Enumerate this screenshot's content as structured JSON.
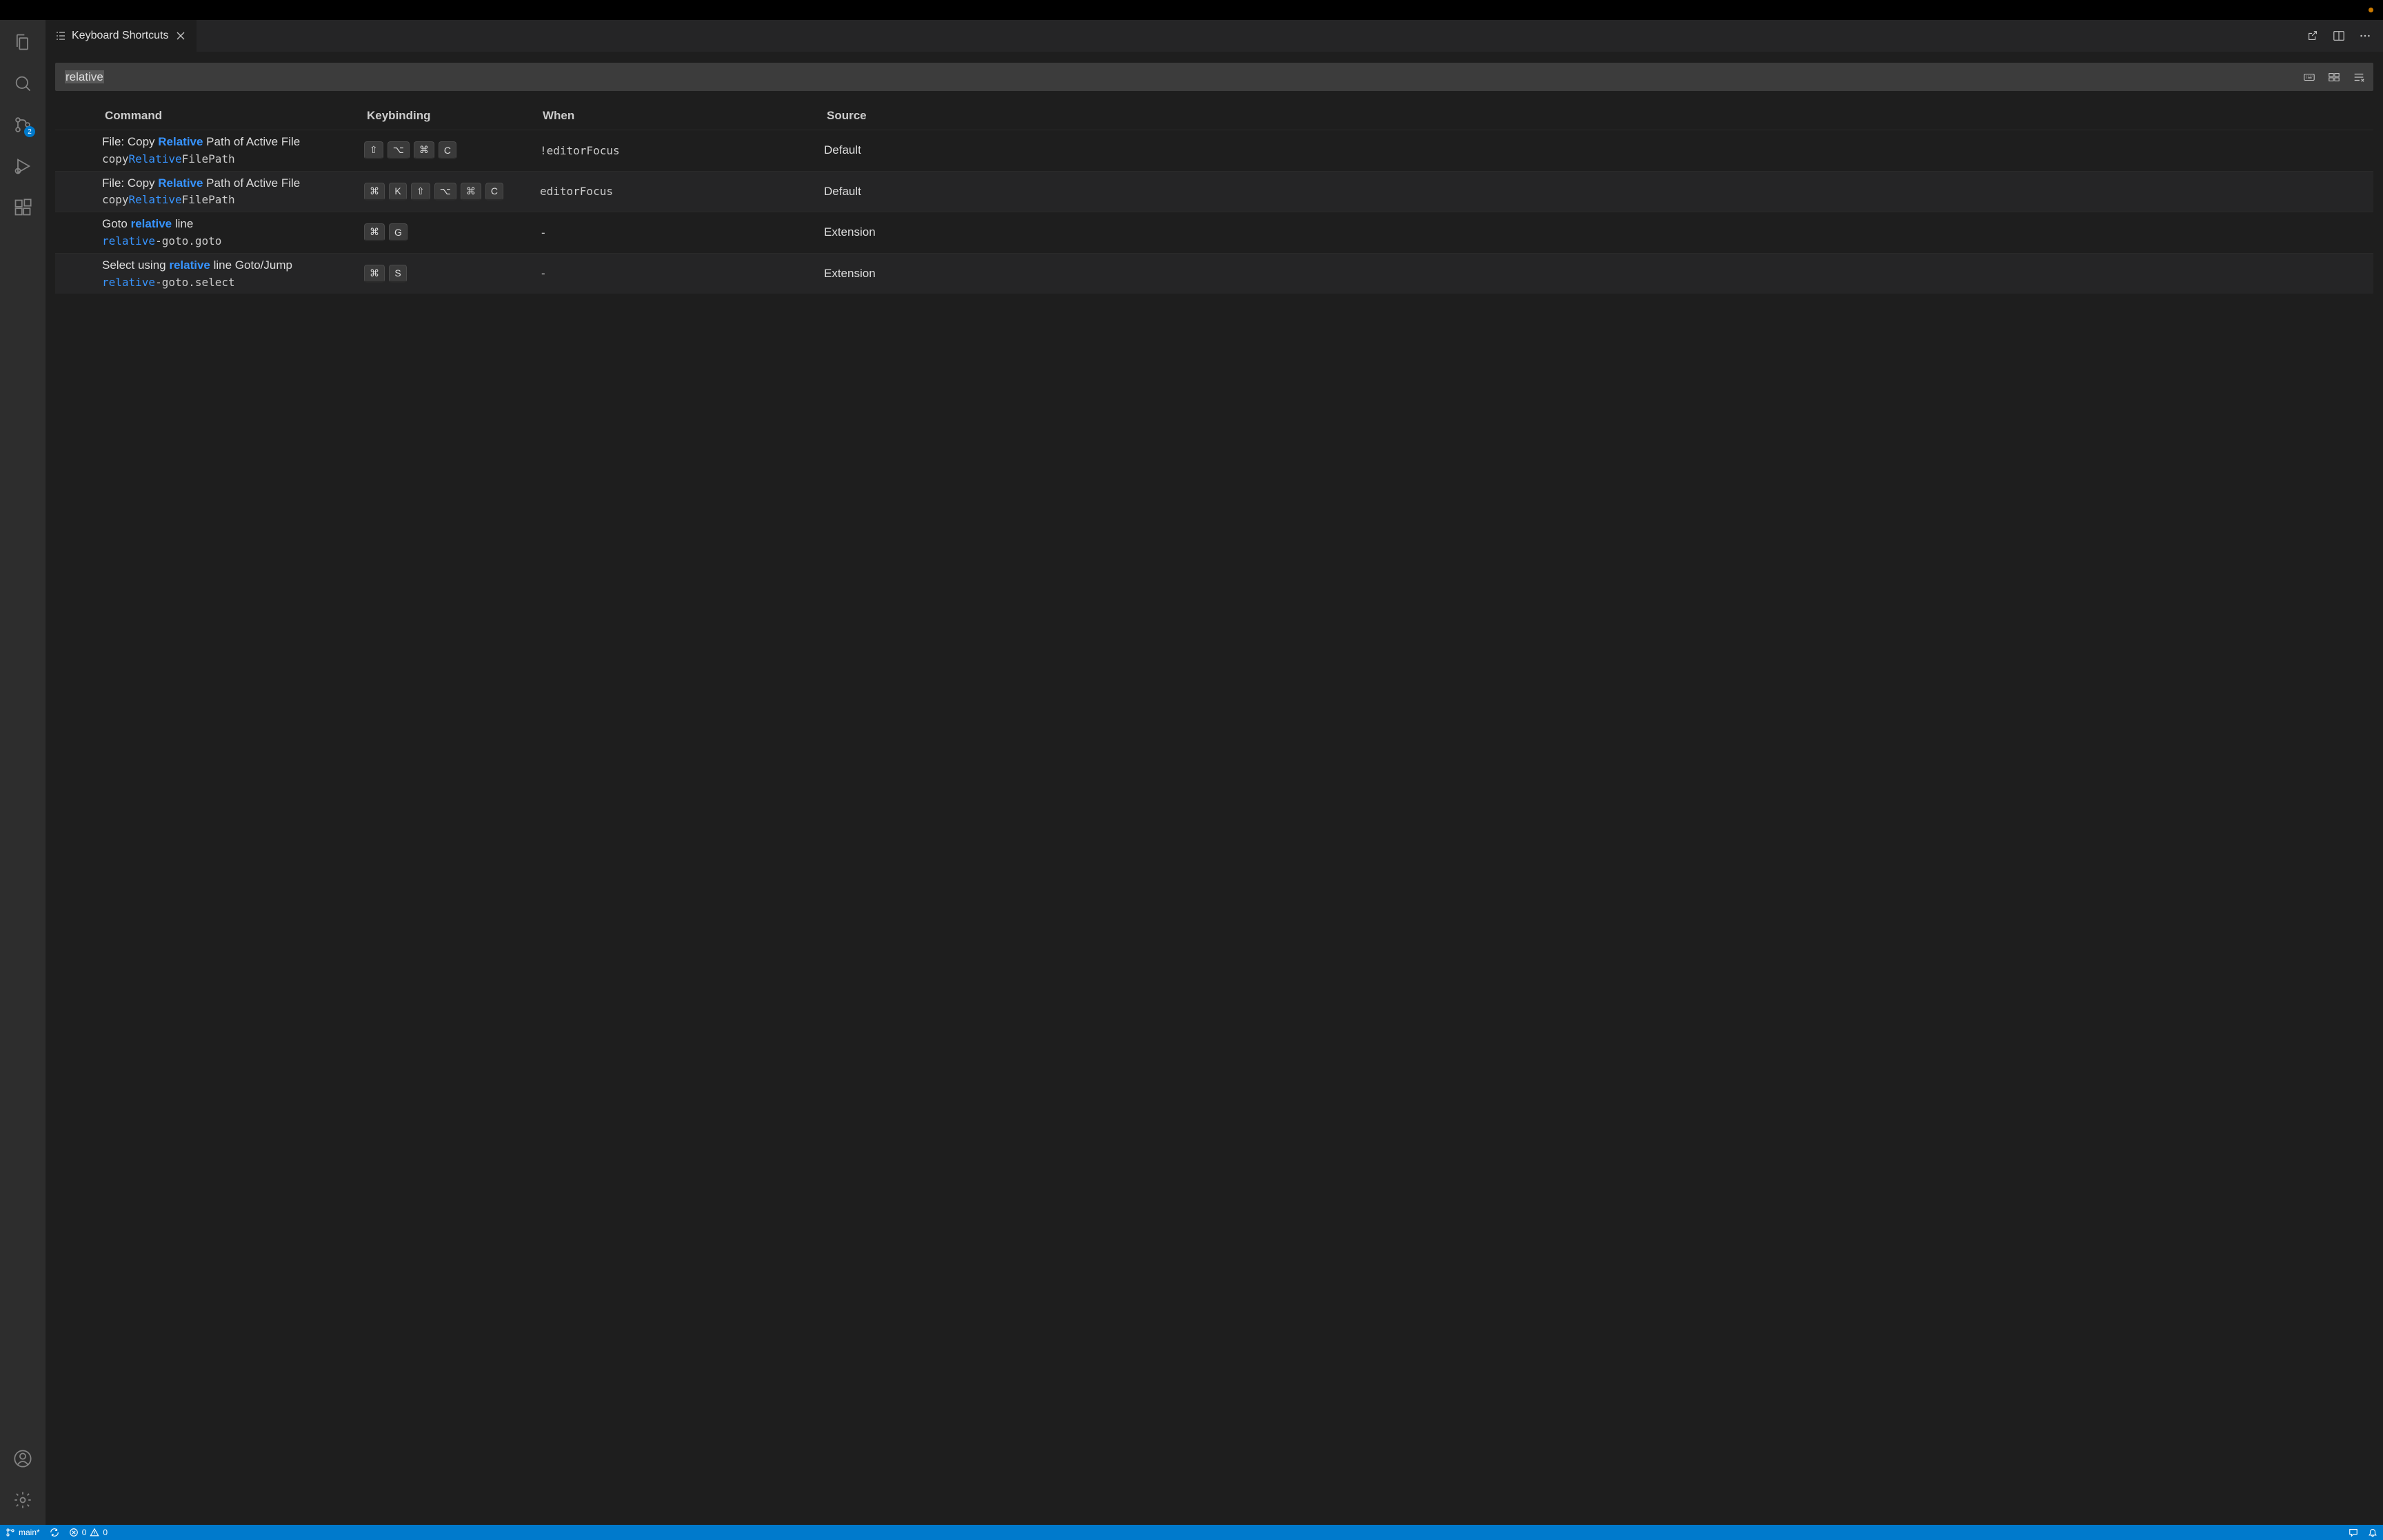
{
  "titlebar": {
    "modified": true
  },
  "activitybar": {
    "scm_badge": "2"
  },
  "tab": {
    "title": "Keyboard Shortcuts"
  },
  "search": {
    "value": "relative"
  },
  "table": {
    "headers": {
      "command": "Command",
      "keybinding": "Keybinding",
      "when": "When",
      "source": "Source"
    },
    "rows": [
      {
        "cmd_pre": "File: Copy ",
        "cmd_hl": "Relative",
        "cmd_post": " Path of Active File",
        "id_pre": "copy",
        "id_hl": "Relative",
        "id_post": "FilePath",
        "keys": [
          "⇧",
          "⌥",
          "⌘",
          "C"
        ],
        "when": "!editorFocus",
        "source": "Default"
      },
      {
        "cmd_pre": "File: Copy ",
        "cmd_hl": "Relative",
        "cmd_post": " Path of Active File",
        "id_pre": "copy",
        "id_hl": "Relative",
        "id_post": "FilePath",
        "keys": [
          "⌘",
          "K",
          "⇧",
          "⌥",
          "⌘",
          "C"
        ],
        "when": "editorFocus",
        "source": "Default"
      },
      {
        "cmd_pre": "Goto ",
        "cmd_hl": "relative",
        "cmd_post": " line",
        "id_pre": "",
        "id_hl": "relative",
        "id_post": "-goto.goto",
        "keys": [
          "⌘",
          "G"
        ],
        "when": "-",
        "source": "Extension"
      },
      {
        "cmd_pre": "Select using ",
        "cmd_hl": "relative",
        "cmd_post": " line Goto/Jump",
        "id_pre": "",
        "id_hl": "relative",
        "id_post": "-goto.select",
        "keys": [
          "⌘",
          "S"
        ],
        "when": "-",
        "source": "Extension"
      }
    ]
  },
  "statusbar": {
    "branch": "main*",
    "errors": "0",
    "warnings": "0"
  }
}
